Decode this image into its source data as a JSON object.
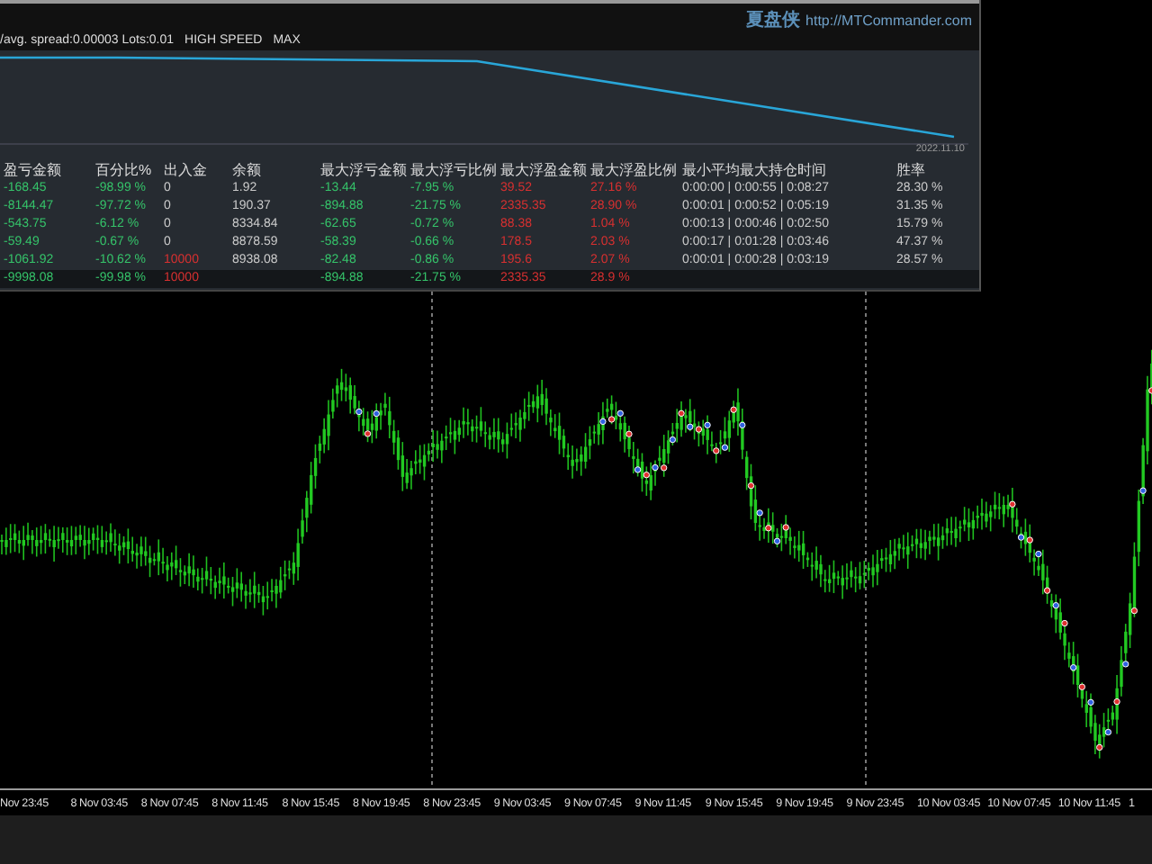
{
  "panel": {
    "brand": "夏盘侠",
    "url": "http://MTCommander.com",
    "stats": [
      "/avg. spread:0.00003 Lots:0.01",
      "HIGH SPEED",
      "MAX"
    ],
    "equity_date": "2022.11.10"
  },
  "table": {
    "columns": [
      "盈亏金额",
      "百分比%",
      "出入金",
      "余额",
      "最大浮亏金额",
      "最大浮亏比例",
      "最大浮盈金额",
      "最大浮盈比例",
      "最小平均最大持仓时间",
      "胜率"
    ],
    "rows": [
      {
        "kind": "trade",
        "deposit_highlight": false,
        "cells": [
          "-168.45",
          "-98.99 %",
          "0",
          "1.92",
          "-13.44",
          "-7.95 %",
          "39.52",
          "27.16 %",
          "0:00:00 | 0:00:55 | 0:08:27",
          "28.30 %"
        ]
      },
      {
        "kind": "trade",
        "deposit_highlight": false,
        "cells": [
          "-8144.47",
          "-97.72 %",
          "0",
          "190.37",
          "-894.88",
          "-21.75 %",
          "2335.35",
          "28.90 %",
          "0:00:01 | 0:00:52 | 0:05:19",
          "31.35 %"
        ]
      },
      {
        "kind": "trade",
        "deposit_highlight": false,
        "cells": [
          "-543.75",
          "-6.12 %",
          "0",
          "8334.84",
          "-62.65",
          "-0.72 %",
          "88.38",
          "1.04 %",
          "0:00:13 | 0:00:46 | 0:02:50",
          "15.79 %"
        ]
      },
      {
        "kind": "trade",
        "deposit_highlight": false,
        "cells": [
          "-59.49",
          "-0.67 %",
          "0",
          "8878.59",
          "-58.39",
          "-0.66 %",
          "178.5",
          "2.03 %",
          "0:00:17 | 0:01:28 | 0:03:46",
          "47.37 %"
        ]
      },
      {
        "kind": "trade",
        "deposit_highlight": true,
        "cells": [
          "-1061.92",
          "-10.62 %",
          "10000",
          "8938.08",
          "-82.48",
          "-0.86 %",
          "195.6",
          "2.07 %",
          "0:00:01 | 0:00:28 | 0:03:19",
          "28.57 %"
        ]
      },
      {
        "kind": "total",
        "deposit_highlight": true,
        "cells": [
          "-9998.08",
          "-99.98 %",
          "10000",
          "",
          "-894.88",
          "-21.75 %",
          "2335.35",
          "28.9 %",
          "",
          ""
        ]
      }
    ]
  },
  "time_axis": [
    "Nov 23:45",
    "8 Nov 03:45",
    "8 Nov 07:45",
    "8 Nov 11:45",
    "8 Nov 15:45",
    "8 Nov 19:45",
    "8 Nov 23:45",
    "9 Nov 03:45",
    "9 Nov 07:45",
    "9 Nov 11:45",
    "9 Nov 15:45",
    "9 Nov 19:45",
    "9 Nov 23:45",
    "10 Nov 03:45",
    "10 Nov 07:45",
    "10 Nov 11:45",
    "1"
  ]
}
